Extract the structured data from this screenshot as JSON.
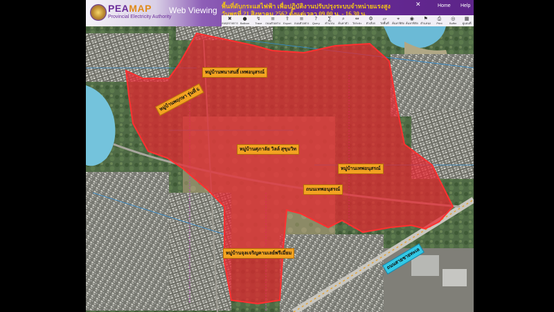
{
  "header": {
    "logo_title_pea": "PEA",
    "logo_title_map": "MAP",
    "logo_subtitle": "Provincial Electricity Authority",
    "web_viewing": "Web Viewing",
    "notice_line1": "พื้นที่ดับกระแสไฟฟ้า เพื่อปฏิบัติงานปรับปรุงระบบจำหน่ายแรงสูง",
    "notice_line2": "วันพุธที่ 21 สิงหาคม 2562 ตั้งแต่เวลา 09.00 น. - 16.30 น.",
    "nav_home": "Home",
    "nav_help": "Help"
  },
  "toolbar": {
    "items": [
      {
        "label": "ลบทุกรายการ",
        "icon": "delete-icon"
      },
      {
        "label": "Balloon",
        "icon": "balloon-icon"
      },
      {
        "label": "Trace",
        "icon": "trace-icon"
      },
      {
        "label": "ถนนตัวอย่าง",
        "icon": "road-icon"
      },
      {
        "label": "Export",
        "icon": "export-icon"
      },
      {
        "label": "ถนนตัวอย่าง",
        "icon": "road-icon"
      },
      {
        "label": "Query",
        "icon": "query-icon"
      },
      {
        "label": "คำนวณ",
        "icon": "calculate-icon"
      },
      {
        "label": "ค้นหาตัว",
        "icon": "search-icon"
      },
      {
        "label": "วัดระยะ",
        "icon": "measure-icon"
      },
      {
        "label": "ตัวเลือก",
        "icon": "options-icon"
      },
      {
        "label": "วัดพื้นที่",
        "icon": "area-icon"
      },
      {
        "label": "ค้นหาพิกัด",
        "icon": "coordinate-icon"
      },
      {
        "label": "ค้นหาพิกัด",
        "icon": "location-icon"
      },
      {
        "label": "ตำแหน่ง",
        "icon": "position-icon"
      },
      {
        "label": "Print",
        "icon": "print-icon"
      },
      {
        "label": "Buffer",
        "icon": "buffer-icon"
      },
      {
        "label": "ดูแผนที่",
        "icon": "map-icon"
      }
    ]
  },
  "map": {
    "outage_color": "#e8262f",
    "labels": {
      "village_top": "หมู่บ้านพนาสนธิ์ เทพอนุสรณ์",
      "village_left": "หมู่บ้านพฤกษา รุ่นที่ 6",
      "village_center": "หมู่บ้านศุภาลัย วิลล์ สุขุมวิท",
      "village_right": "หมู่บ้านเทพอนุสรณ์",
      "road_center": "ถนนเทพอนุสรณ์",
      "village_bottom": "หมู่บ้านจุลเจริญคามเลย์พรีเมี่ยม",
      "road_bottom": "ถนนสายชายทะเล"
    }
  }
}
